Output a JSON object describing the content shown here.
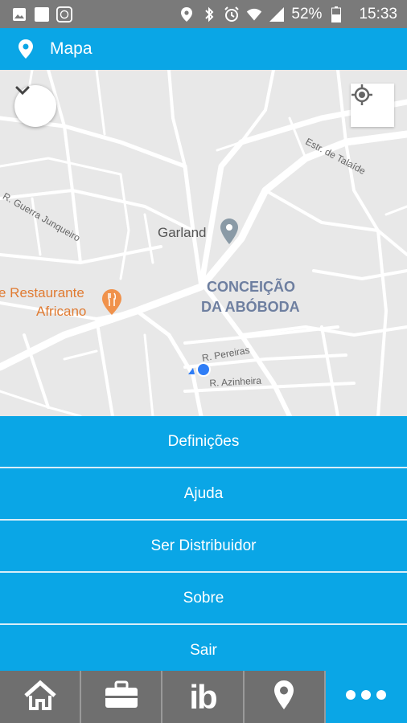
{
  "status_bar": {
    "battery": "52%",
    "time": "15:33",
    "icons": [
      "image-icon",
      "square-app-icon",
      "app-logo-icon",
      "location-icon",
      "bluetooth-icon",
      "alarm-icon",
      "wifi-icon",
      "signal-icon",
      "battery-icon"
    ]
  },
  "header": {
    "title": "Mapa",
    "icon": "map-pin-icon"
  },
  "map": {
    "labels": {
      "garland": "Garland",
      "restaurant_1": "e Restaurante",
      "restaurant_2": "Africano",
      "area_1": "CONCEIÇÃO",
      "area_2": "DA ABÓBODA",
      "street_guerra": "R. Guerra Junqueiro",
      "street_talaide": "Estr. de Talaíde",
      "street_pereiras": "R. Pereiras",
      "street_azinheira": "R. Azinheira"
    },
    "colors": {
      "poi_gray": "#8a9aa6",
      "poi_orange": "#f0924c",
      "user_dot": "#2f7df6",
      "area_text": "#6e7fa0"
    }
  },
  "menu": {
    "items": [
      "Definições",
      "Ajuda",
      "Ser Distribuidor",
      "Sobre",
      "Sair"
    ]
  },
  "bottom_nav": {
    "items": [
      "home-icon",
      "briefcase-icon",
      "ib-logo",
      "map-pin-icon",
      "more-icon"
    ],
    "ib_text": "ib",
    "active_index": 4
  },
  "colors": {
    "accent": "#0aa6e6",
    "status_bar": "#7a7a7a",
    "nav_bar": "#6f6f6f"
  }
}
